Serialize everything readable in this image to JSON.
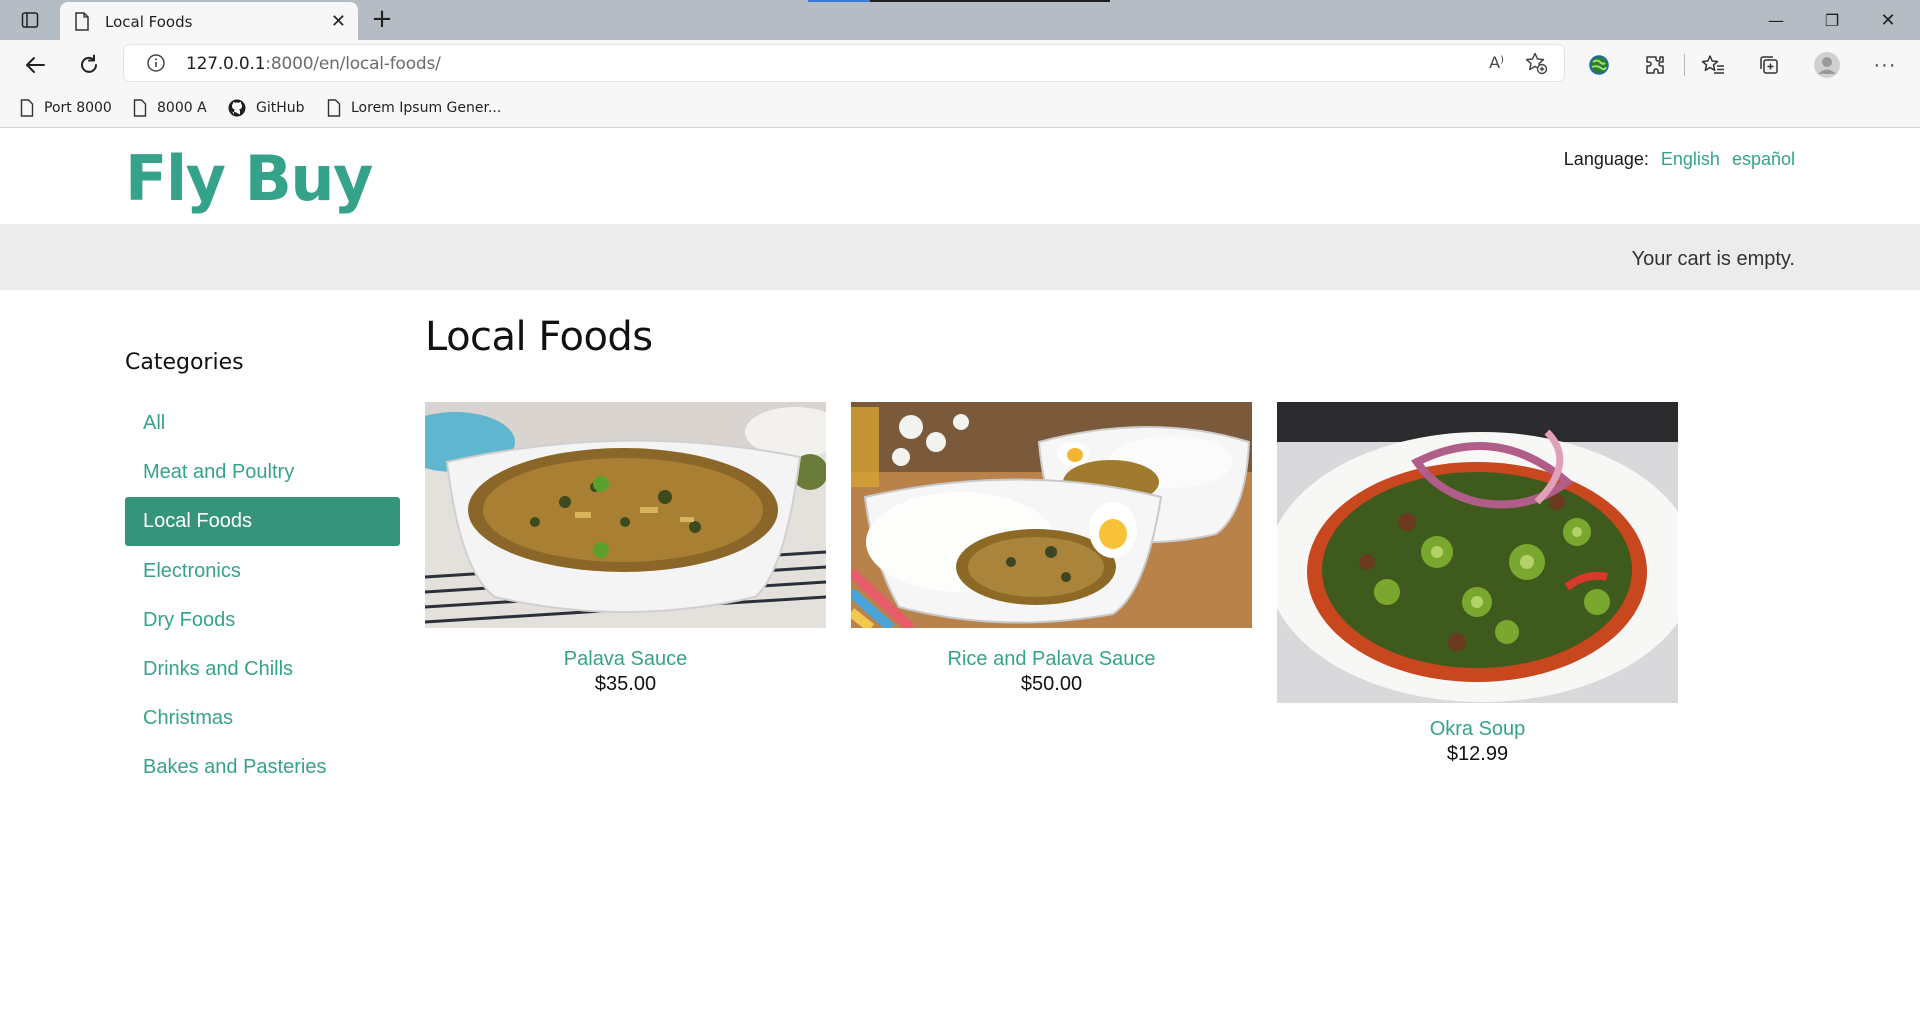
{
  "browser": {
    "tab_title": "Local Foods",
    "new_tab": "+",
    "url_host": "127.0.0.1",
    "url_path": ":8000/en/local-foods/",
    "read_aloud": "A⁾",
    "window_controls": {
      "minimize": "—",
      "restore": "❐",
      "close": "✕"
    },
    "bookmarks": [
      {
        "label": "Port 8000",
        "icon": "page-icon"
      },
      {
        "label": "8000 A",
        "icon": "page-icon"
      },
      {
        "label": "GitHub",
        "icon": "github-icon"
      },
      {
        "label": "Lorem Ipsum Gener...",
        "icon": "page-icon"
      }
    ]
  },
  "site": {
    "logo": "Fly Buy",
    "language_label": "Language:",
    "languages": [
      "English",
      "español"
    ],
    "cart_text": "Your cart is empty."
  },
  "sidebar": {
    "title": "Categories",
    "categories": [
      "All",
      "Meat and Poultry",
      "Local Foods",
      "Electronics",
      "Dry Foods",
      "Drinks and Chills",
      "Christmas",
      "Bakes and Pasteries"
    ],
    "active": "Local Foods"
  },
  "main": {
    "title": "Local Foods",
    "products": [
      {
        "name": "Palava Sauce",
        "price": "$35.00"
      },
      {
        "name": "Rice and Palava Sauce",
        "price": "$50.00"
      },
      {
        "name": "Okra Soup",
        "price": "$12.99"
      }
    ]
  },
  "colors": {
    "accent": "#35a38a",
    "active_bg": "#35957a",
    "cartbar": "#ececec"
  }
}
